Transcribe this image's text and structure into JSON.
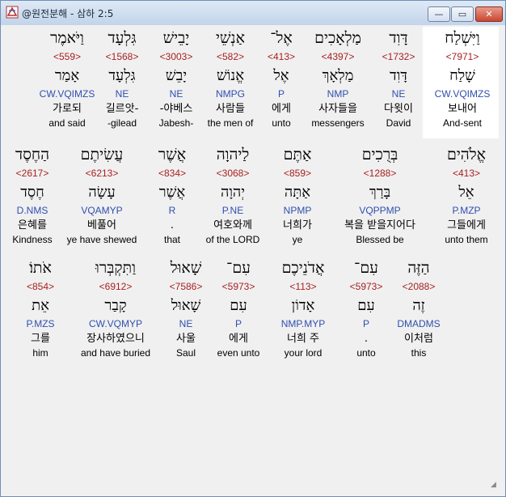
{
  "window": {
    "title": "@원전분해 - 삼하 2:5",
    "min_label": "—",
    "max_label": "▭",
    "close_label": "✕"
  },
  "rows": [
    {
      "words": [
        {
          "heb": "וַיִּשְׁלַח",
          "strong": "<7971>",
          "lemma": "שָׁלַח",
          "parse": "CW.VQIMZS",
          "kor": "보내어",
          "eng": "And-sent"
        },
        {
          "heb": "דָּוִד",
          "strong": "<1732>",
          "lemma": "דָּוִד",
          "parse": "NE",
          "kor": "다윗이",
          "eng": "David"
        },
        {
          "heb": "מַלְאָכִים",
          "strong": "<4397>",
          "lemma": "מַלְאָךְ",
          "parse": "NMP",
          "kor": "사자들을",
          "eng": "messengers"
        },
        {
          "heb": "אֶל־",
          "strong": "<413>",
          "lemma": "אֶל",
          "parse": "P",
          "kor": "에게",
          "eng": "unto"
        },
        {
          "heb": "אַנְשֵׁי",
          "strong": "<582>",
          "lemma": "אֱנוֹשׁ",
          "parse": "NMPG",
          "kor": "사람들",
          "eng": "the men of"
        },
        {
          "heb": "יָבֵישׁ",
          "strong": "<3003>",
          "lemma": "יָבֵשׁ",
          "parse": "NE",
          "kor": "-야베스",
          "eng": "Jabesh-"
        },
        {
          "heb": "גִּלְעָד",
          "strong": "<1568>",
          "lemma": "גִּלְעָד",
          "parse": "NE",
          "kor": "길르앗-",
          "eng": "-gilead"
        },
        {
          "heb": "וַיֹּאמֶר",
          "strong": "<559>",
          "lemma": "אָמַר",
          "parse": "CW.VQIMZS",
          "kor": "가로되",
          "eng": "and said"
        }
      ]
    },
    {
      "words": [
        {
          "heb": "אֱלֹהִים",
          "strong": "<413>",
          "lemma": "אֵל",
          "parse": "P.MZP",
          "kor": "그들에게",
          "eng": "unto them"
        },
        {
          "heb": "בְּרֻכִים",
          "strong": "<1288>",
          "lemma": "בָּרַךְ",
          "parse": "VQPPMP",
          "kor": "복을 받을지어다",
          "eng": "Blessed be"
        },
        {
          "heb": "אַתֶּם",
          "strong": "<859>",
          "lemma": "אַתָּה",
          "parse": "NPMP",
          "kor": "너희가",
          "eng": "ye"
        },
        {
          "heb": "לַיהוָה",
          "strong": "<3068>",
          "lemma": "יְהוָה",
          "parse": "P.NE",
          "kor": "여호와께",
          "eng": "of the LORD"
        },
        {
          "heb": "אֲשֶׁר",
          "strong": "<834>",
          "lemma": "אֲשֶׁר",
          "parse": "R",
          "kor": ".",
          "eng": "that"
        },
        {
          "heb": "עֲשִׂיתֶם",
          "strong": "<6213>",
          "lemma": "עָשָׂה",
          "parse": "VQAMYP",
          "kor": "베풀어",
          "eng": "ye have shewed"
        },
        {
          "heb": "הַחֶסֶד",
          "strong": "<2617>",
          "lemma": "חֶסֶד",
          "parse": "D.NMS",
          "kor": "은혜를",
          "eng": "Kindness"
        }
      ]
    },
    {
      "words": [
        {
          "heb": "הַזֶּה",
          "strong": "<2088>",
          "lemma": "זֶה",
          "parse": "DMADMS",
          "kor": "이처럼",
          "eng": "this"
        },
        {
          "heb": "עִם־",
          "strong": "<5973>",
          "lemma": "עִם",
          "parse": "P",
          "kor": ".",
          "eng": "unto"
        },
        {
          "heb": "אֲדֹנֵיכֶם",
          "strong": "<113>",
          "lemma": "אָדוֹן",
          "parse": "NMP.MYP",
          "kor": "너희 주",
          "eng": "your lord"
        },
        {
          "heb": "עִם־",
          "strong": "<5973>",
          "lemma": "עִם",
          "parse": "P",
          "kor": "에게",
          "eng": "even unto"
        },
        {
          "heb": "שָׁאוּל",
          "strong": "<7586>",
          "lemma": "שָׁאוּל",
          "parse": "NE",
          "kor": "사울",
          "eng": "Saul"
        },
        {
          "heb": "וַתִּקְבְּרוּ",
          "strong": "<6912>",
          "lemma": "קָבַר",
          "parse": "CW.VQMYP",
          "kor": "장사하였으니",
          "eng": "and have buried"
        },
        {
          "heb": "אֹתוֹ׃",
          "strong": "<854>",
          "lemma": "אֵת",
          "parse": "P.MZS",
          "kor": "그를",
          "eng": "him"
        }
      ]
    }
  ]
}
